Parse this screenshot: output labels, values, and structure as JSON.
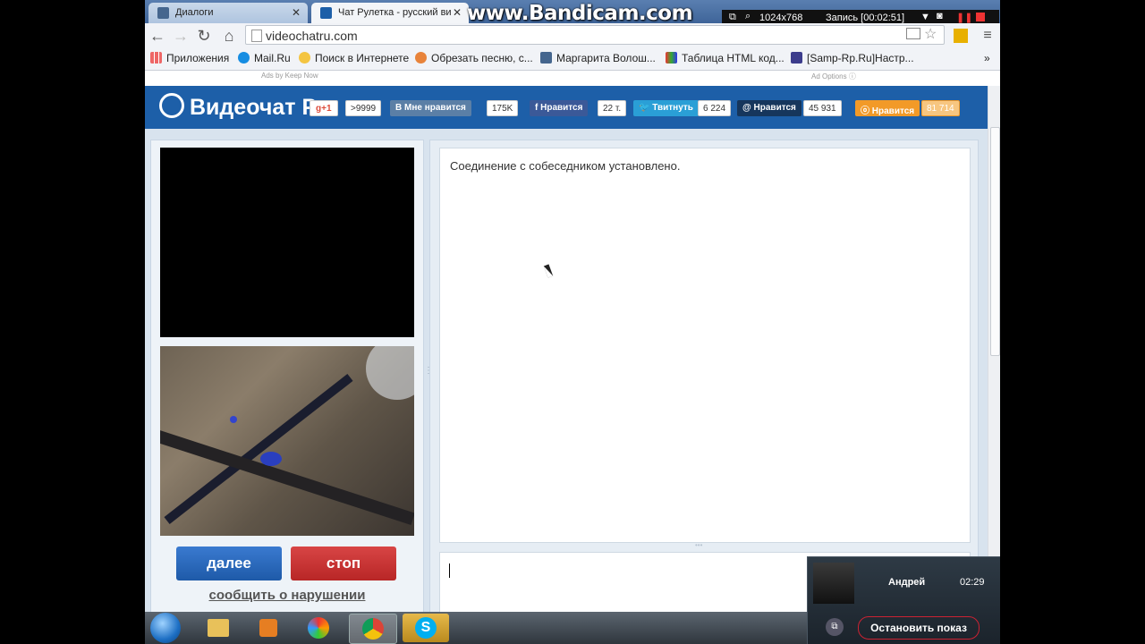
{
  "browser": {
    "tabs": [
      {
        "label": "Диалоги"
      },
      {
        "label": "Чат Рулетка - русский ви"
      }
    ],
    "url": "videochatru.com",
    "bookmarks": [
      {
        "label": "Приложения"
      },
      {
        "label": "Mail.Ru"
      },
      {
        "label": "Поиск в Интернете"
      },
      {
        "label": "Обрезать песню, с..."
      },
      {
        "label": "Маргарита Волош..."
      },
      {
        "label": "Таблица HTML код..."
      },
      {
        "label": "[Samp-Rp.Ru]Настр..."
      }
    ]
  },
  "overlay": {
    "watermark": "www.Bandicam.com",
    "resolution": "1024x768",
    "record_status": "Запись [00:02:51]"
  },
  "page": {
    "ads_label": "Ads by Keep Now",
    "ad_options": "Ad Options",
    "logo": "Видеочат Р",
    "social": [
      {
        "label": "g+1",
        "count": ">9999",
        "color": "#dd4b39"
      },
      {
        "label": "Мне нравится",
        "count": "175K",
        "color": "#5b7fa6"
      },
      {
        "label": "Нравится",
        "count": "22 т.",
        "color": "#3b5998"
      },
      {
        "label": "Твитнуть",
        "count": "6 224",
        "color": "#2a9fd6"
      },
      {
        "label": "Нравится",
        "count": "45 931",
        "color": "#16365c"
      },
      {
        "label": "Нравится",
        "count": "81 714",
        "color": "#f29a28"
      }
    ],
    "next_button": "далее",
    "stop_button": "стоп",
    "report_link": "сообщить о нарушении",
    "chat_message": "Соединение с собеседником установлено."
  },
  "skype_notification": {
    "name": "Андрей",
    "time": "02:29",
    "action": "Остановить показ"
  }
}
